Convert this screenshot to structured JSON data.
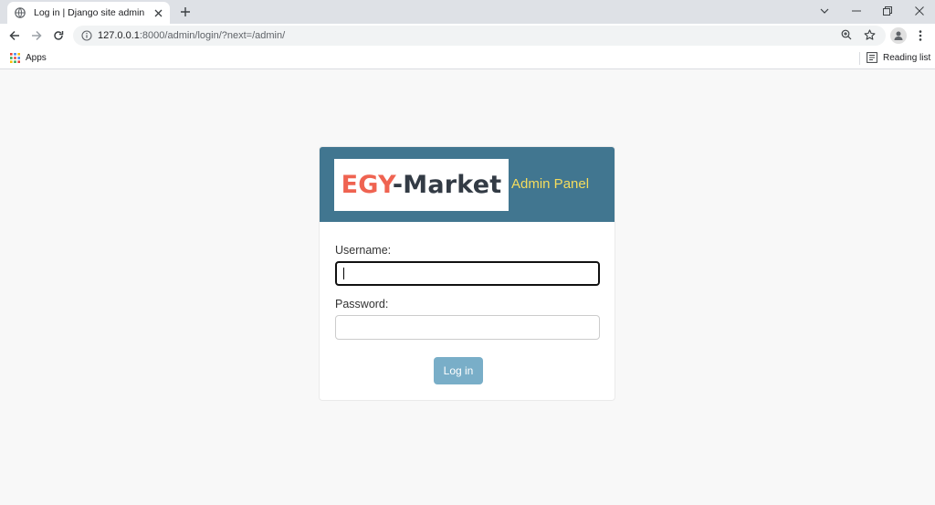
{
  "browser": {
    "tab": {
      "title": "Log in | Django site admin"
    },
    "address_bar": {
      "host": "127.0.0.1",
      "rest": ":8000/admin/login/?next=/admin/"
    },
    "bookmarks": {
      "apps_label": "Apps",
      "reading_list_label": "Reading list"
    }
  },
  "login": {
    "logo": {
      "part1": "EGY",
      "part2": "-Market"
    },
    "subtitle": "Admin Panel",
    "username": {
      "label": "Username:",
      "value": ""
    },
    "password": {
      "label": "Password:",
      "value": ""
    },
    "submit_label": "Log in"
  },
  "colors": {
    "header_bg": "#417690",
    "logo_accent": "#ef6351",
    "logo_dark": "#333b45",
    "subtitle": "#f5dd5d",
    "button_bg": "#79aec8",
    "page_bg": "#f8f8f8"
  },
  "icons": {
    "tab_favicon": "globe-icon",
    "tab_close": "close-icon",
    "new_tab": "plus-icon",
    "back": "arrow-left-icon",
    "forward": "arrow-right-icon",
    "reload": "reload-icon",
    "site_info": "info-icon",
    "zoom": "zoom-icon",
    "bookmark": "star-icon",
    "profile": "person-icon",
    "menu": "kebab-menu-icon",
    "apps": "apps-grid-icon",
    "reading_list": "reading-list-icon"
  }
}
